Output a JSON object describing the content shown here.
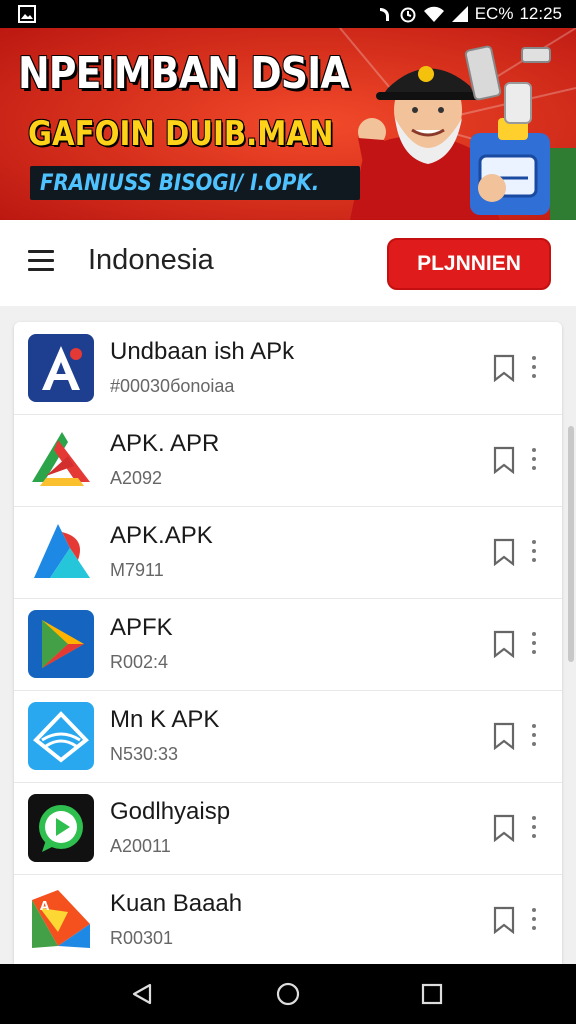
{
  "status_bar": {
    "battery": "EC%",
    "time": "12:25"
  },
  "banner": {
    "line1": "NPEIMBAN DSIA",
    "line2": "GAFOIN DUIB.MAN",
    "line3": "FRANIUSS BISOGI/ I.OPK."
  },
  "toolbar": {
    "title": "Indonesia",
    "button_label": "PLJNNIEN"
  },
  "apps": [
    {
      "name": "Undbaan ish APk",
      "sub": "#00030бonoiaa",
      "icon": "app-a-icon"
    },
    {
      "name": "APK. APR",
      "sub": "A2092",
      "icon": "app-red-green-icon"
    },
    {
      "name": "APK.APK",
      "sub": "M7911",
      "icon": "app-triangle-icon"
    },
    {
      "name": "APFK",
      "sub": "R002:4",
      "icon": "app-play-icon"
    },
    {
      "name": "Mn K APK",
      "sub": "N530:33",
      "icon": "app-wave-icon"
    },
    {
      "name": "Godlhyaisp",
      "sub": "A20011",
      "icon": "app-whatsapp-icon"
    },
    {
      "name": "Kuan Baaah",
      "sub": "R00301",
      "icon": "app-colorful-icon"
    }
  ],
  "colors": {
    "accent": "#e01b1b",
    "banner_red": "#d71f1f",
    "banner_yellow": "#ffd21a"
  }
}
